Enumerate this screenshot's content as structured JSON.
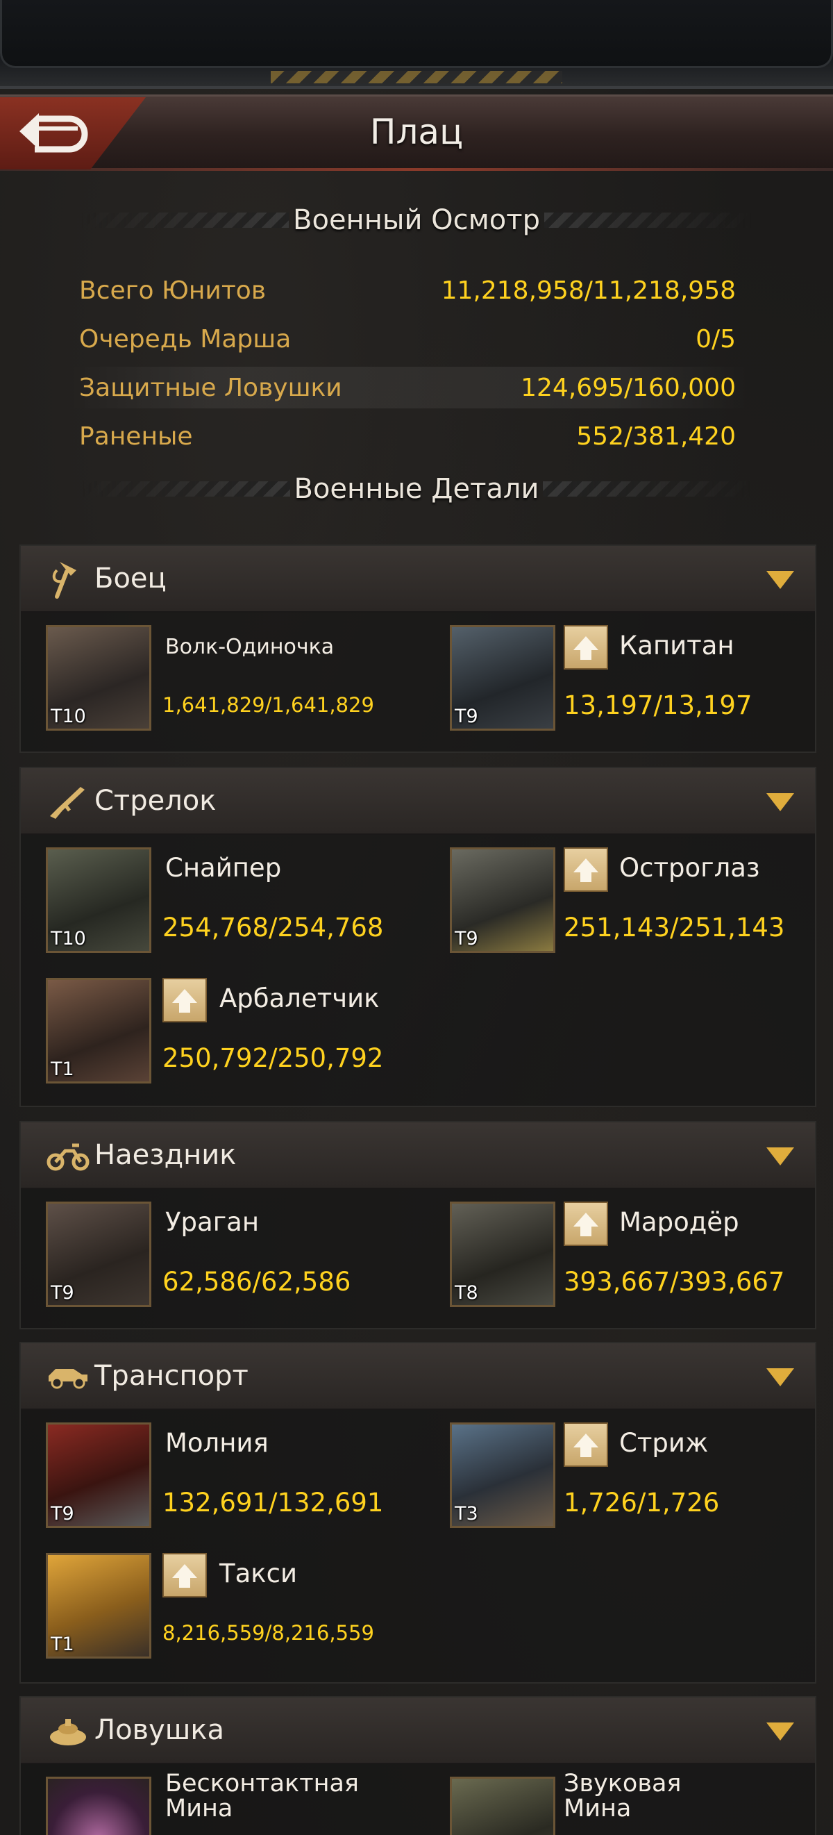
{
  "header": {
    "title": "Плац"
  },
  "overview": {
    "heading": "Военный Осмотр",
    "rows": [
      {
        "label": "Всего Юнитов",
        "value": "11,218,958/11,218,958"
      },
      {
        "label": "Очередь Марша",
        "value": "0/5"
      },
      {
        "label": "Защитные Ловушки",
        "value": "124,695/160,000"
      },
      {
        "label": "Раненые",
        "value": "552/381,420"
      }
    ]
  },
  "details": {
    "heading": "Военные Детали"
  },
  "categories": [
    {
      "name": "Боец",
      "icon": "axe-icon",
      "units": [
        {
          "name": "Волк-Одиночка",
          "tier": "T10",
          "count": "1,641,829/1,641,829",
          "upgrade": false
        },
        {
          "name": "Капитан",
          "tier": "T9",
          "count": "13,197/13,197",
          "upgrade": true
        }
      ]
    },
    {
      "name": "Стрелок",
      "icon": "rifle-icon",
      "units": [
        {
          "name": "Снайпер",
          "tier": "T10",
          "count": "254,768/254,768",
          "upgrade": false
        },
        {
          "name": "Остроглаз",
          "tier": "T9",
          "count": "251,143/251,143",
          "upgrade": true
        },
        {
          "name": "Арбалетчик",
          "tier": "T1",
          "count": "250,792/250,792",
          "upgrade": true
        }
      ]
    },
    {
      "name": "Наездник",
      "icon": "motorcycle-icon",
      "units": [
        {
          "name": "Ураган",
          "tier": "T9",
          "count": "62,586/62,586",
          "upgrade": false
        },
        {
          "name": "Мародёр",
          "tier": "T8",
          "count": "393,667/393,667",
          "upgrade": true
        }
      ]
    },
    {
      "name": "Транспорт",
      "icon": "car-icon",
      "units": [
        {
          "name": "Молния",
          "tier": "T9",
          "count": "132,691/132,691",
          "upgrade": false
        },
        {
          "name": "Стриж",
          "tier": "T3",
          "count": "1,726/1,726",
          "upgrade": true
        },
        {
          "name": "Такси",
          "tier": "T1",
          "count": "8,216,559/8,216,559",
          "upgrade": true
        }
      ]
    },
    {
      "name": "Ловушка",
      "icon": "mine-icon",
      "units": [
        {
          "name": "Бесконтактная Мина"
        },
        {
          "name": "Звуковая Мина"
        }
      ]
    }
  ],
  "colors": {
    "label": "#d8a94c",
    "value": "#ffd21f",
    "accent": "#e0ad3c"
  }
}
